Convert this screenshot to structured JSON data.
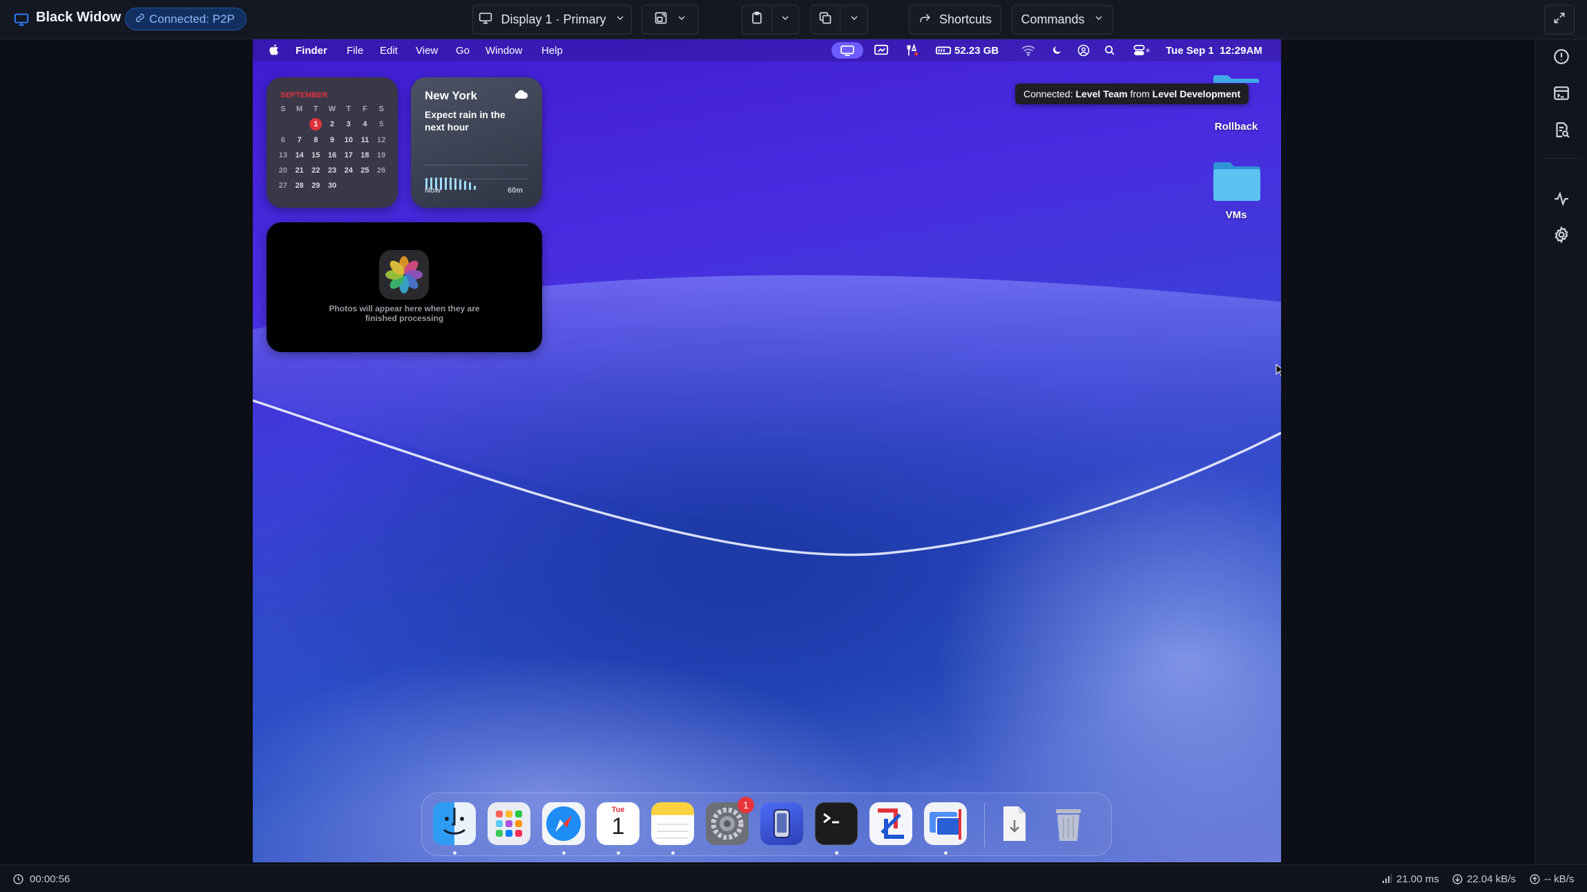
{
  "app": {
    "title": "Black Widow",
    "connection": "Connected: P2P"
  },
  "toolbar": {
    "display": "Display 1 · Primary",
    "shortcuts": "Shortcuts",
    "commands": "Commands"
  },
  "menubar": {
    "items": [
      "Finder",
      "File",
      "Edit",
      "View",
      "Go",
      "Window",
      "Help"
    ],
    "storage": "52.23 GB",
    "datetime": "Tue Sep 1  12:29AM"
  },
  "tooltip": {
    "prefix": "Connected: ",
    "team": "Level Team",
    "mid": " from ",
    "org": "Level Development"
  },
  "desktop": {
    "folders": [
      "Rollback",
      "VMs"
    ]
  },
  "calendar": {
    "month": "SEPTEMBER",
    "weekdays": [
      "S",
      "M",
      "T",
      "W",
      "T",
      "F",
      "S"
    ],
    "weeks": [
      [
        "",
        "",
        "1",
        "2",
        "3",
        "4",
        "5"
      ],
      [
        "6",
        "7",
        "8",
        "9",
        "10",
        "11",
        "12"
      ],
      [
        "13",
        "14",
        "15",
        "16",
        "17",
        "18",
        "19"
      ],
      [
        "20",
        "21",
        "22",
        "23",
        "24",
        "25",
        "26"
      ],
      [
        "27",
        "28",
        "29",
        "30",
        "",
        "",
        ""
      ]
    ],
    "today": "1"
  },
  "weather": {
    "city": "New York",
    "forecast": "Expect rain in the next hour",
    "start_label": "Now",
    "end_label": "60m"
  },
  "photos": {
    "message": "Photos will appear here when they are finished processing"
  },
  "dock": {
    "calendar_day": "Tue",
    "calendar_date": "1",
    "settings_badge": "1"
  },
  "status": {
    "timer": "00:00:56",
    "latency": "21.00 ms",
    "download": "22.04 kB/s",
    "upload": "-- kB/s"
  },
  "colors": {
    "accent": "#2f7bff",
    "badge_bg": "#12305f",
    "wallpaper_top": "#3e1bd0",
    "wallpaper_bottom": "#2a4fc4"
  }
}
